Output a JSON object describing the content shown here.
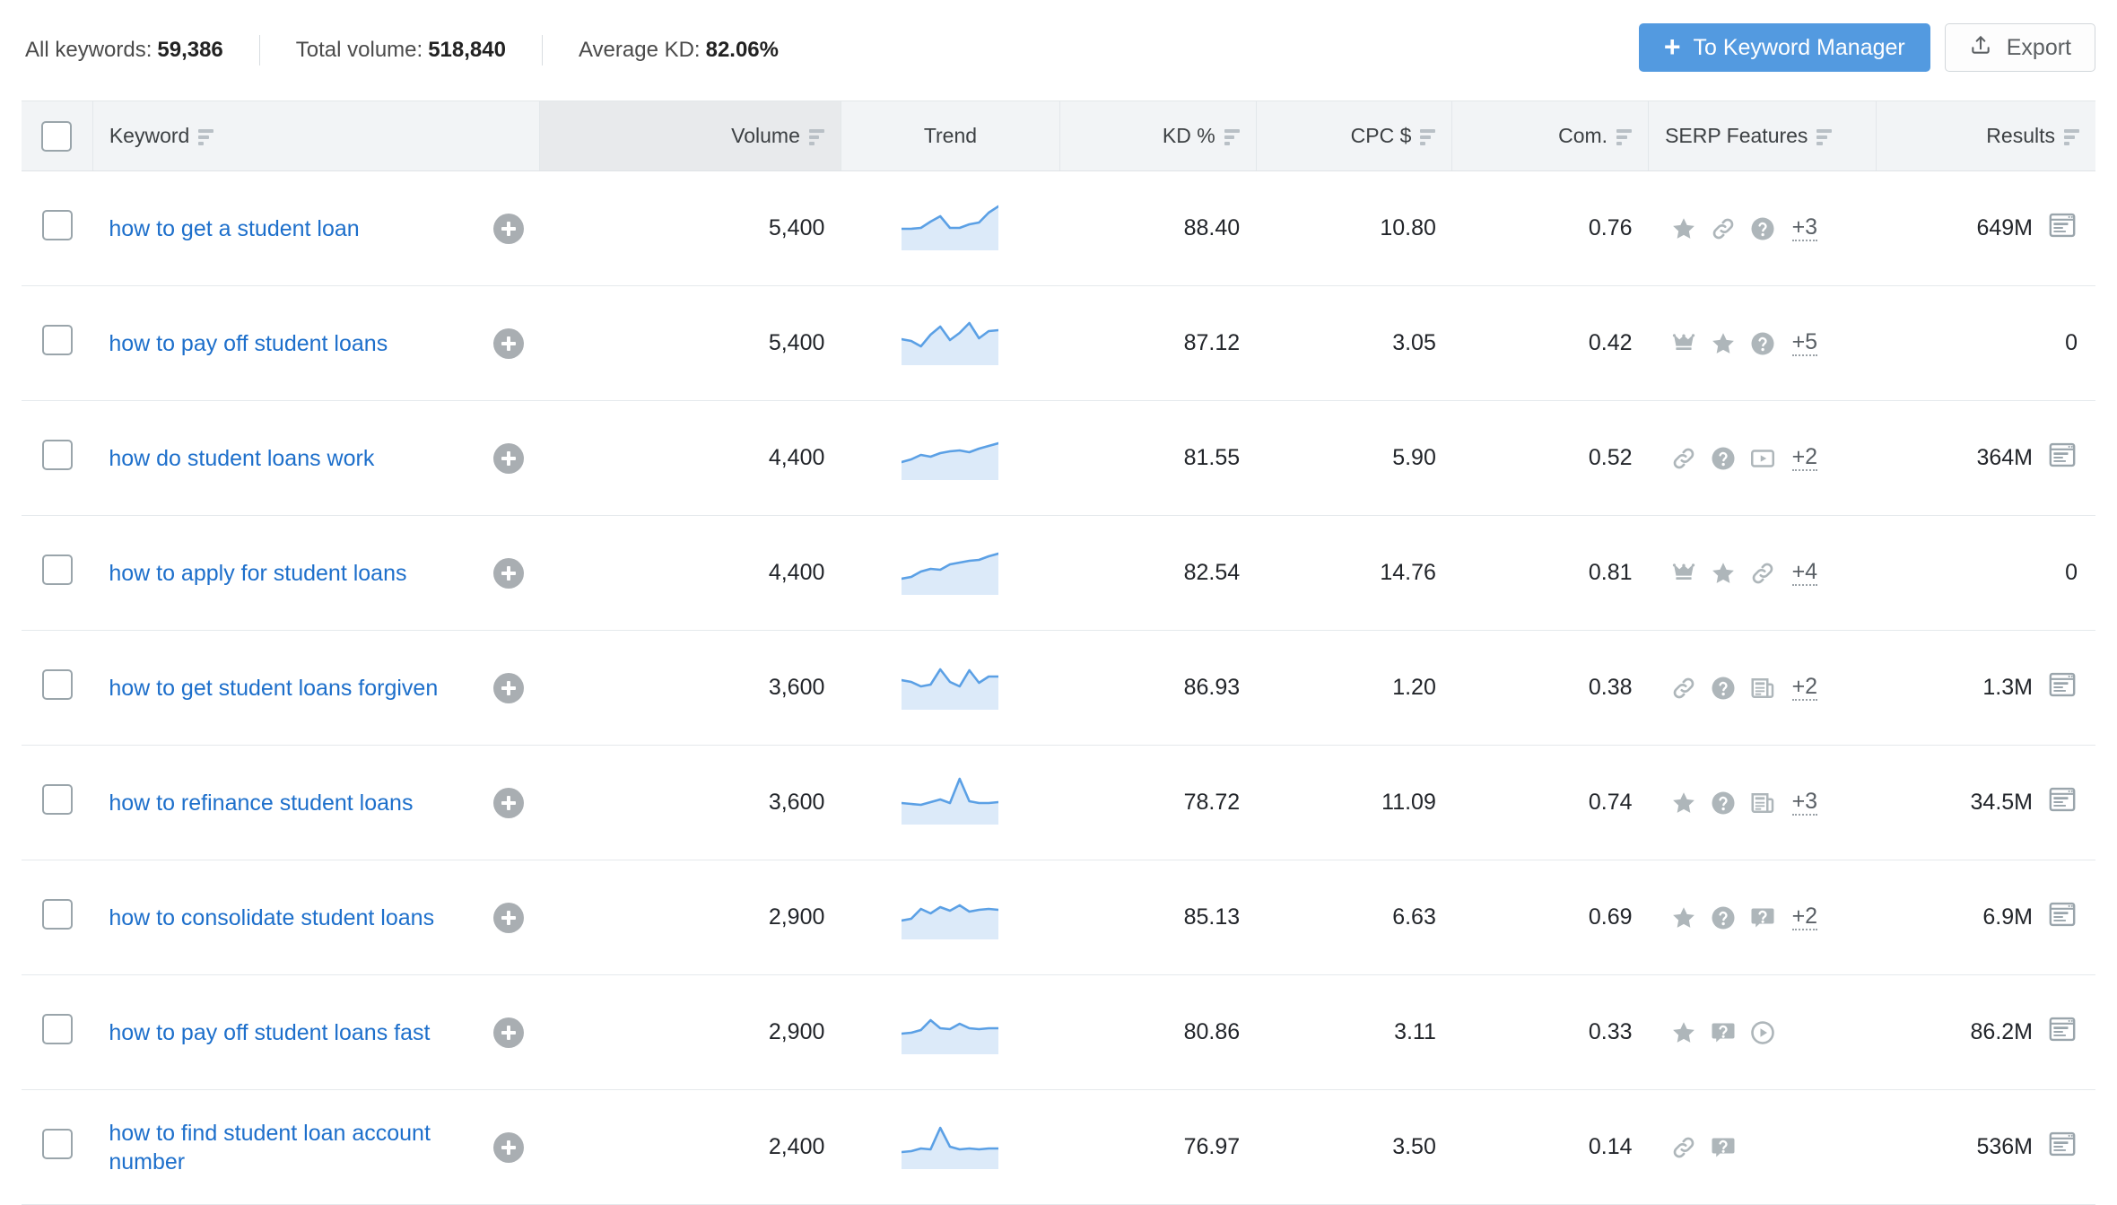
{
  "summary": {
    "items": [
      {
        "label": "All keywords:",
        "value": "59,386"
      },
      {
        "label": "Total volume:",
        "value": "518,840"
      },
      {
        "label": "Average KD:",
        "value": "82.06%"
      }
    ]
  },
  "actions": {
    "keyword_manager_label": "To Keyword Manager",
    "keyword_manager_plus": "+",
    "export_label": "Export"
  },
  "colors": {
    "primary_button": "#539ae0",
    "link": "#1d6fcb",
    "sparkline_stroke": "#5ba0e5",
    "sparkline_fill": "#dceaf9",
    "icon_gray": "#aeb6ba",
    "header_bg": "#f2f4f6",
    "sorted_column_bg": "#e8eaec"
  },
  "table": {
    "columns": [
      {
        "key": "select",
        "label": "",
        "sortable": false,
        "align": "center"
      },
      {
        "key": "keyword",
        "label": "Keyword",
        "sortable": true,
        "align": "left"
      },
      {
        "key": "volume",
        "label": "Volume",
        "sortable": true,
        "align": "right",
        "sorted": true
      },
      {
        "key": "trend",
        "label": "Trend",
        "sortable": false,
        "align": "center"
      },
      {
        "key": "kd",
        "label": "KD %",
        "sortable": true,
        "align": "right"
      },
      {
        "key": "cpc",
        "label": "CPC $",
        "sortable": true,
        "align": "right"
      },
      {
        "key": "com",
        "label": "Com.",
        "sortable": true,
        "align": "right"
      },
      {
        "key": "serp",
        "label": "SERP Features",
        "sortable": true,
        "align": "left"
      },
      {
        "key": "results",
        "label": "Results",
        "sortable": true,
        "align": "right"
      }
    ],
    "rows": [
      {
        "keyword": "how to get a student loan",
        "volume": "5,400",
        "kd": "88.40",
        "cpc": "10.80",
        "com": "0.76",
        "serp_icons": [
          "star-icon",
          "link-icon",
          "question-circle-icon"
        ],
        "serp_more": "+3",
        "results": "649M",
        "has_serp_preview": true,
        "trend": [
          0.42,
          0.42,
          0.44,
          0.58,
          0.7,
          0.44,
          0.44,
          0.52,
          0.56,
          0.78,
          0.92
        ]
      },
      {
        "keyword": "how to pay off student loans",
        "volume": "5,400",
        "kd": "87.12",
        "cpc": "3.05",
        "com": "0.42",
        "serp_icons": [
          "crown-icon",
          "star-icon",
          "question-circle-icon"
        ],
        "serp_more": "+5",
        "results": "0",
        "has_serp_preview": false,
        "trend": [
          0.52,
          0.48,
          0.36,
          0.62,
          0.8,
          0.5,
          0.66,
          0.88,
          0.54,
          0.7,
          0.72
        ]
      },
      {
        "keyword": "how do student loans work",
        "volume": "4,400",
        "kd": "81.55",
        "cpc": "5.90",
        "com": "0.52",
        "serp_icons": [
          "link-icon",
          "question-circle-icon",
          "video-icon"
        ],
        "serp_more": "+2",
        "results": "364M",
        "has_serp_preview": true,
        "trend": [
          0.34,
          0.4,
          0.5,
          0.46,
          0.54,
          0.58,
          0.6,
          0.56,
          0.64,
          0.7,
          0.76
        ]
      },
      {
        "keyword": "how to apply for student loans",
        "volume": "4,400",
        "kd": "82.54",
        "cpc": "14.76",
        "com": "0.81",
        "serp_icons": [
          "crown-icon",
          "star-icon",
          "link-icon"
        ],
        "serp_more": "+4",
        "results": "0",
        "has_serp_preview": false,
        "trend": [
          0.3,
          0.34,
          0.46,
          0.52,
          0.5,
          0.62,
          0.66,
          0.7,
          0.72,
          0.8,
          0.86
        ]
      },
      {
        "keyword": "how to get student loans forgiven",
        "volume": "3,600",
        "kd": "86.93",
        "cpc": "1.20",
        "com": "0.38",
        "serp_icons": [
          "link-icon",
          "question-circle-icon",
          "news-icon"
        ],
        "serp_more": "+2",
        "results": "1.3M",
        "has_serp_preview": true,
        "trend": [
          0.6,
          0.56,
          0.46,
          0.5,
          0.84,
          0.56,
          0.46,
          0.82,
          0.54,
          0.68,
          0.68
        ]
      },
      {
        "keyword": "how to refinance student loans",
        "volume": "3,600",
        "kd": "78.72",
        "cpc": "11.09",
        "com": "0.74",
        "serp_icons": [
          "star-icon",
          "question-circle-icon",
          "news-icon"
        ],
        "serp_more": "+3",
        "results": "34.5M",
        "has_serp_preview": true,
        "trend": [
          0.42,
          0.4,
          0.38,
          0.44,
          0.5,
          0.42,
          0.96,
          0.46,
          0.42,
          0.42,
          0.44
        ]
      },
      {
        "keyword": "how to consolidate student loans",
        "volume": "2,900",
        "kd": "85.13",
        "cpc": "6.63",
        "com": "0.69",
        "serp_icons": [
          "star-icon",
          "question-circle-icon",
          "question-box-icon"
        ],
        "serp_more": "+2",
        "results": "6.9M",
        "has_serp_preview": true,
        "trend": [
          0.36,
          0.4,
          0.62,
          0.52,
          0.66,
          0.58,
          0.7,
          0.56,
          0.6,
          0.62,
          0.6
        ]
      },
      {
        "keyword": "how to pay off student loans fast",
        "volume": "2,900",
        "kd": "80.86",
        "cpc": "3.11",
        "com": "0.33",
        "serp_icons": [
          "star-icon",
          "question-box-icon",
          "play-circle-icon"
        ],
        "serp_more": "",
        "results": "86.2M",
        "has_serp_preview": true,
        "trend": [
          0.4,
          0.42,
          0.48,
          0.7,
          0.52,
          0.5,
          0.62,
          0.52,
          0.5,
          0.52,
          0.52
        ]
      },
      {
        "keyword": "how to find student loan account number",
        "volume": "2,400",
        "kd": "76.97",
        "cpc": "3.50",
        "com": "0.14",
        "serp_icons": [
          "link-icon",
          "question-box-icon"
        ],
        "serp_more": "",
        "results": "536M",
        "has_serp_preview": true,
        "trend": [
          0.32,
          0.34,
          0.4,
          0.38,
          0.86,
          0.44,
          0.38,
          0.4,
          0.38,
          0.4,
          0.4
        ]
      }
    ]
  }
}
